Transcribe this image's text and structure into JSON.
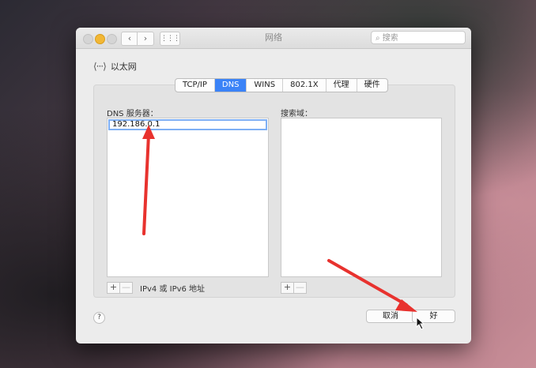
{
  "window": {
    "title": "网络",
    "search_placeholder": "搜索",
    "nav_back": "‹",
    "nav_forward": "›",
    "grid": "⋮⋮⋮"
  },
  "header": {
    "service_icon": "⟨···⟩",
    "service_name": "以太网"
  },
  "tabs": [
    "TCP/IP",
    "DNS",
    "WINS",
    "802.1X",
    "代理",
    "硬件"
  ],
  "active_tab": "DNS",
  "dns": {
    "label": "DNS 服务器：",
    "entries": [
      "192.186.0.1"
    ],
    "hint": "IPv4 或 IPv6 地址"
  },
  "search_domains": {
    "label": "搜索域："
  },
  "controls": {
    "add": "+",
    "remove": "—"
  },
  "footer": {
    "help": "?",
    "cancel": "取消",
    "ok": "好"
  },
  "colors": {
    "accent": "#3b83f7",
    "annotation_arrow": "#e8322e",
    "minimize": "#f2b735"
  }
}
